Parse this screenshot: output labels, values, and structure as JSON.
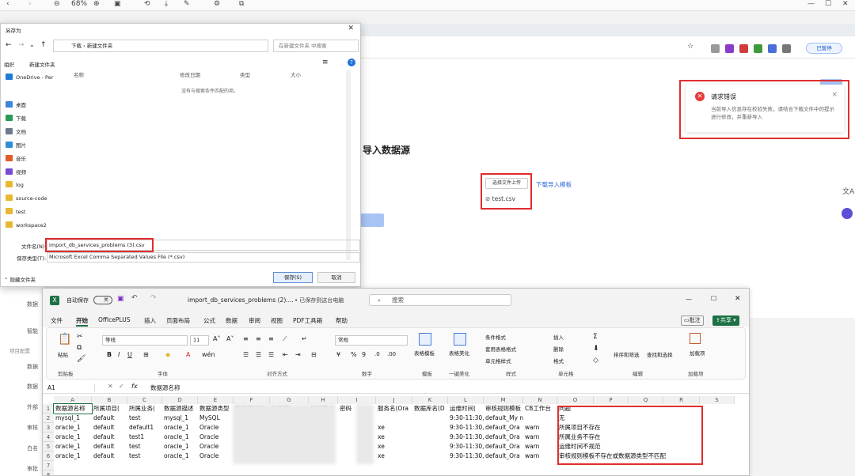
{
  "topbar": {
    "zoom": "68%"
  },
  "browser": {
    "update_label": "已暂停",
    "page_title": "导入数据源",
    "upload": {
      "button": "选择文件上传",
      "file": "test.csv"
    },
    "download_link": "下载导入模板",
    "toast": {
      "title": "请求错误",
      "message": "当前导入信息存在校验失败，请结合下载文件中的提示进行修改，并重新导入"
    }
  },
  "app_sidebar": {
    "items": [
      "数据",
      "智能",
      "项目配置",
      "数据",
      "数据",
      "外部",
      "审核",
      "白名",
      "审批"
    ]
  },
  "save_dialog": {
    "title": "另存为",
    "path": [
      "下载",
      "新建文件夹"
    ],
    "search_placeholder": "在新建文件夹 中搜索",
    "organize": "组织",
    "new_folder": "新建文件夹",
    "tree": [
      "OneDrive - Per",
      "桌面",
      "下载",
      "文档",
      "图片",
      "音乐",
      "视频",
      "log",
      "source-code",
      "test",
      "workspace2"
    ],
    "columns": [
      "名称",
      "修改日期",
      "类型",
      "大小"
    ],
    "empty_msg": "没有与搜索条件匹配的项。",
    "filename_label": "文件名(N):",
    "filename": "import_db_services_problems (3).csv",
    "filetype_label": "保存类型(T):",
    "filetype": "Microsoft Excel Comma Separated Values File (*.csv)",
    "hide_folders": "隐藏文件夹",
    "save": "保存(S)",
    "cancel": "取消"
  },
  "excel": {
    "autosave": "自动保存",
    "autosave_state": "关",
    "doc_title": "import_db_services_problems (2)....",
    "saved_state": "• 已保存到这台电脑",
    "search": "搜索",
    "menu": [
      "文件",
      "开始",
      "OfficePLUS",
      "插入",
      "页面布局",
      "公式",
      "数据",
      "审阅",
      "视图",
      "PDF工具箱",
      "帮助"
    ],
    "comment": "批注",
    "share": "共享",
    "ribbon": {
      "paste": "粘贴",
      "font": "等线",
      "font_size": "11",
      "number_format": "常规",
      "groups": [
        "剪贴板",
        "字体",
        "对齐方式",
        "数字",
        "模板",
        "一键美化",
        "样式",
        "单元格",
        "编辑",
        "加载项"
      ],
      "table_template": "表格模板",
      "table_beautify": "表格美化",
      "cond_format": "条件格式",
      "table_format": "套用表格格式",
      "cell_style": "单元格样式",
      "insert": "插入",
      "delete": "删除",
      "format": "格式",
      "sort": "排序和筛选",
      "find": "查找和选择",
      "addin": "加载项"
    },
    "name_box": "A1",
    "formula": "数据源名称",
    "columns": [
      "A",
      "B",
      "C",
      "D",
      "E",
      "F",
      "G",
      "H",
      "I",
      "J",
      "K",
      "L",
      "M",
      "N",
      "O",
      "P",
      "Q",
      "R",
      "S"
    ],
    "headers": [
      "数据源名称",
      "所属项目(",
      "所属业务(",
      "数据源描述",
      "数据源类型",
      "数据源地址",
      "数据源",
      "连接用户",
      "密码",
      "服务名(Ora",
      "数据库名(D",
      "运维时间(",
      "审核规则模板",
      "CB工作台",
      "问题"
    ],
    "rows": [
      [
        "mysql_1",
        "default",
        "test",
        "mysql_1",
        "MySQL",
        "",
        "",
        "",
        "",
        "",
        "",
        "9:30-11:30,",
        "default_My notice",
        "",
        "无"
      ],
      [
        "oracle_1",
        "default",
        "default1",
        "oracle_1",
        "Oracle",
        "",
        "",
        "",
        "",
        "xe",
        "",
        "9:30-11:30,",
        "default_Ora",
        "warn",
        "所属项目不存在"
      ],
      [
        "oracle_1",
        "default",
        "test1",
        "oracle_1",
        "Oracle",
        "",
        "",
        "",
        "",
        "xe",
        "",
        "9:30-11:30,",
        "default_Ora",
        "warn",
        "所属业务不存在"
      ],
      [
        "oracle_1",
        "default",
        "test",
        "oracle_1",
        "Oracle",
        "",
        "",
        "",
        "",
        "xe",
        "",
        "9:30-11:30,",
        "default_Ora",
        "warn",
        "运维时间不规范"
      ],
      [
        "oracle_1",
        "default",
        "test",
        "oracle_1",
        "Oracle",
        "",
        "",
        "",
        "",
        "xe",
        "",
        "9:30-11:30,",
        "default_Ora",
        "warn",
        "审核规则模板不存在或数据源类型不匹配"
      ]
    ]
  }
}
